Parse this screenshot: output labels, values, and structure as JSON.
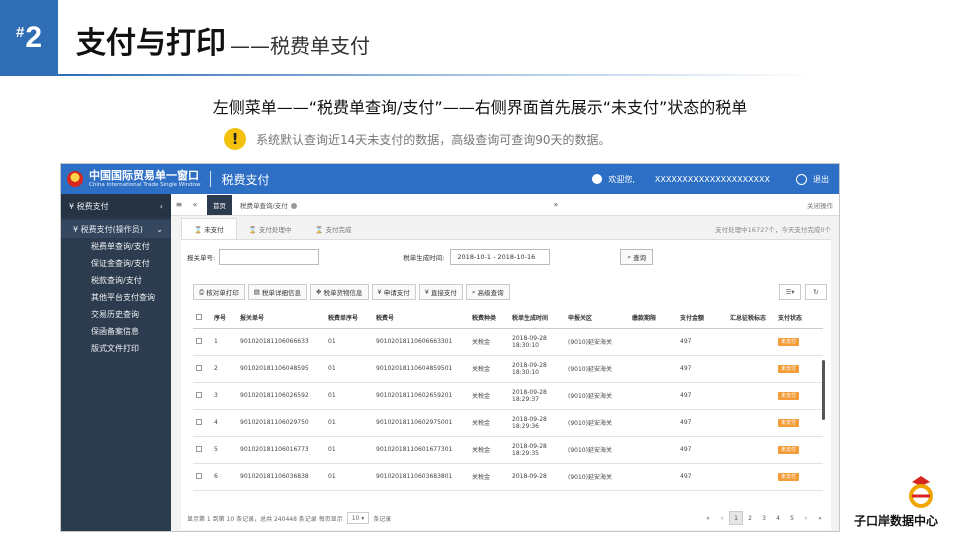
{
  "slide": {
    "number": "2",
    "number_prefix": "#",
    "title": "支付与打印",
    "title_dash": "——",
    "subtitle": "税费单支付",
    "caption": "左侧菜单——“税费单查询/支付”——右侧界面首先展示“未支付”状态的税单",
    "notice_icon": "warning-icon",
    "notice_mark": "!",
    "notice": "系统默认查询近14天未支付的数据，高级查询可查询90天的数据。"
  },
  "app": {
    "brand_cn": "中国国际贸易单一窗口",
    "brand_en": "China International Trade Single Window",
    "module": "税费支付",
    "welcome": "欢迎您,",
    "username": "XXXXXXXXXXXXXXXXXXXXX",
    "exit": "退出"
  },
  "sidebar": {
    "section": "税费支付",
    "subsection": "税费支付(操作员)",
    "items": [
      "税费单查询/支付",
      "保证金查询/支付",
      "税款查询/支付",
      "其他平台支付查询",
      "交易历史查询",
      "保函备案信息",
      "版式文件打印"
    ]
  },
  "tabs": {
    "home": "首页",
    "page": "税费单查询/支付",
    "ops": "关闭操作"
  },
  "status_tabs": [
    "未支付",
    "支付处理中",
    "支付完成"
  ],
  "status_hint": "支付处理中16727个，今天支付完成0个",
  "search": {
    "label_no": "报关单号:",
    "label_time": "税单生成时间:",
    "date_range": "2018-10-1 - 2018-10-16",
    "query": "查询"
  },
  "toolbar": [
    "核对单打印",
    "税单详细信息",
    "税单货物信息",
    "申请支付",
    "直接支付",
    "高级查询"
  ],
  "table": {
    "headers": [
      "序号",
      "报关单号",
      "税费单序号",
      "税费号",
      "税费种类",
      "税单生成时间",
      "申报关区",
      "缴款期限",
      "支付金额",
      "汇总征税标志",
      "支付状态"
    ],
    "rows": [
      [
        "1",
        "901020181106066633",
        "01",
        "9010201811060666330​1",
        "关税金",
        "2018-09-28 18:30:10",
        "(9010)延安海关",
        "",
        "497",
        "",
        "未支付"
      ],
      [
        "2",
        "901020181106048595",
        "01",
        "901020181106048595​01",
        "关税金",
        "2018-09-28 18:30:10",
        "(9010)延安海关",
        "",
        "497",
        "",
        "未支付"
      ],
      [
        "3",
        "901020181106026592",
        "01",
        "901020181106026592​01",
        "关税金",
        "2018-09-28 18:29:37",
        "(9010)延安海关",
        "",
        "497",
        "",
        "未支付"
      ],
      [
        "4",
        "901020181106029750",
        "01",
        "901020181106029750​01",
        "关税金",
        "2018-09-28 18:29:36",
        "(9010)延安海关",
        "",
        "497",
        "",
        "未支付"
      ],
      [
        "5",
        "901020181106016773",
        "01",
        "901020181106016773​01",
        "关税金",
        "2018-09-28 18:29:35",
        "(9010)延安海关",
        "",
        "497",
        "",
        "未支付"
      ],
      [
        "6",
        "901020181106036838",
        "01",
        "901020181106036838​01",
        "关税金",
        "2018-09-28",
        "(9010)延安海关",
        "",
        "497",
        "",
        "未支付"
      ]
    ]
  },
  "footer": {
    "summary": "显示第 1 到第 10 条记录，总共 240448 条记录 每页显示",
    "page_size": "10",
    "suffix": "条记录",
    "pages": [
      "«",
      "‹",
      "1",
      "2",
      "3",
      "4",
      "5",
      "›",
      "»"
    ]
  },
  "watermark": "子口岸数据中心"
}
